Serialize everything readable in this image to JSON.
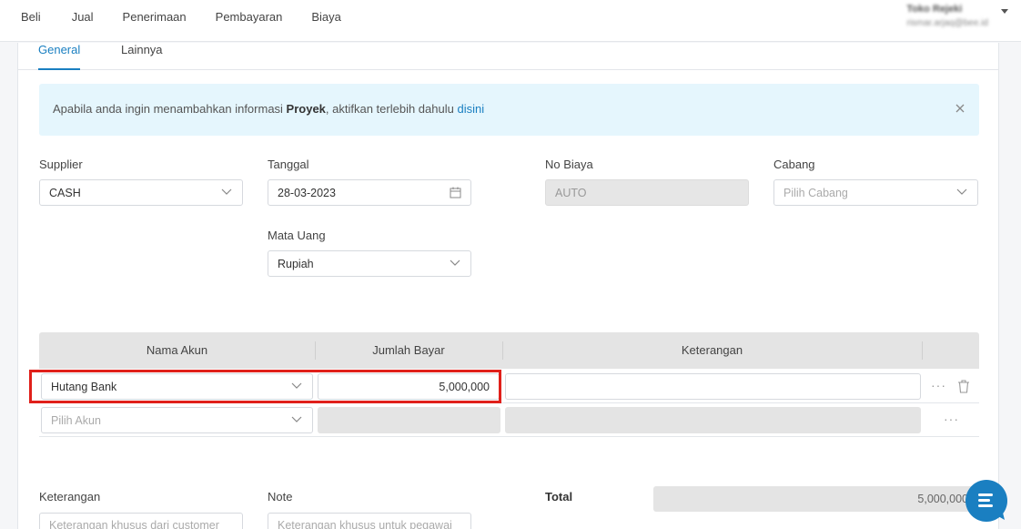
{
  "topnav": {
    "menu": [
      "Beli",
      "Jual",
      "Penerimaan",
      "Pembayaran",
      "Biaya"
    ],
    "user_name": "Toko Rejeki",
    "user_email": "rismar.arjaq@bee.id"
  },
  "tabs": {
    "general": "General",
    "lainnya": "Lainnya"
  },
  "alert": {
    "prefix": "Apabila anda ingin menambahkan informasi ",
    "bold": "Proyek",
    "middle": ", aktifkan terlebih dahulu ",
    "link": "disini"
  },
  "form": {
    "supplier": {
      "label": "Supplier",
      "value": "CASH"
    },
    "tanggal": {
      "label": "Tanggal",
      "value": "28-03-2023"
    },
    "no_biaya": {
      "label": "No Biaya",
      "value": "AUTO"
    },
    "cabang": {
      "label": "Cabang",
      "placeholder": "Pilih Cabang"
    },
    "mata_uang": {
      "label": "Mata Uang",
      "value": "Rupiah"
    }
  },
  "grid": {
    "headers": [
      "Nama Akun",
      "Jumlah Bayar",
      "Keterangan"
    ],
    "rows": [
      {
        "akun": "Hutang Bank",
        "jumlah": "5,000,000",
        "keterangan": ""
      }
    ],
    "new_row_placeholder": "Pilih Akun",
    "dots": "···"
  },
  "footer": {
    "keterangan_label": "Keterangan",
    "keterangan_placeholder": "Keterangan khusus dari customer",
    "note_label": "Note",
    "note_placeholder": "Keterangan khusus untuk pegawai",
    "total_label": "Total",
    "total_value": "5,000,000"
  },
  "colors": {
    "accent": "#1a7fc1",
    "highlight": "#e0201a",
    "alert_bg": "#e5f6fd"
  }
}
